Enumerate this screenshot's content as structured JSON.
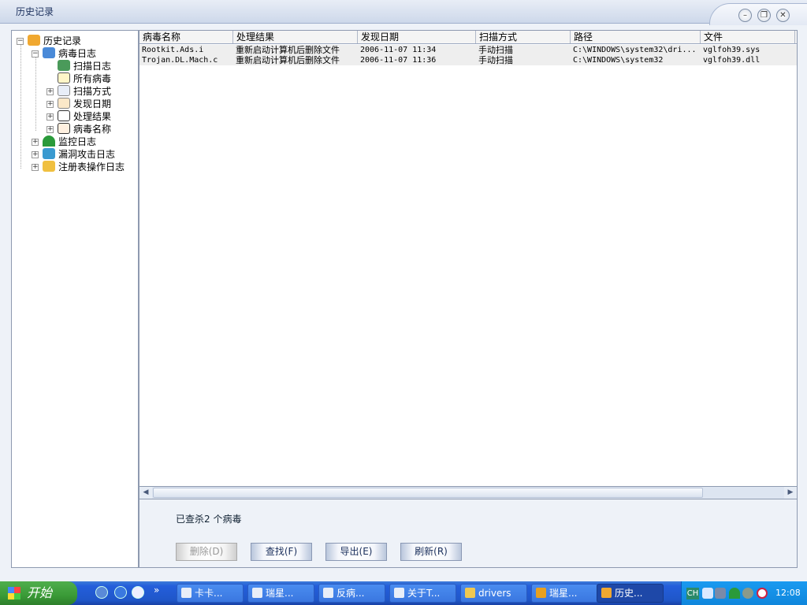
{
  "window": {
    "title": "历史记录",
    "buttons": {
      "minimize": "–",
      "restore": "❐",
      "close": "✕"
    }
  },
  "tree": {
    "root": "历史记录",
    "virus_log": "病毒日志",
    "children": [
      "扫描日志",
      "所有病毒",
      "扫描方式",
      "发现日期",
      "处理结果",
      "病毒名称"
    ],
    "monitor_log": "监控日志",
    "exploit_log": "漏洞攻击日志",
    "registry_log": "注册表操作日志"
  },
  "list": {
    "columns": [
      "病毒名称",
      "处理结果",
      "发现日期",
      "扫描方式",
      "路径",
      "文件"
    ],
    "rows": [
      [
        "Rootkit.Ads.i",
        "重新启动计算机后删除文件",
        "2006-11-07 11:34",
        "手动扫描",
        "C:\\WINDOWS\\system32\\dri...",
        "vglfoh39.sys"
      ],
      [
        "Trojan.DL.Mach.c",
        "重新启动计算机后删除文件",
        "2006-11-07 11:36",
        "手动扫描",
        "C:\\WINDOWS\\system32",
        "vglfoh39.dll"
      ]
    ]
  },
  "status": "已查杀2 个病毒",
  "buttons": {
    "delete": "删除(D)",
    "find": "查找(F)",
    "export": "导出(E)",
    "refresh": "刷新(R)"
  },
  "taskbar": {
    "start": "开始",
    "more": "»",
    "tasks": [
      "卡卡...",
      "瑞星...",
      "反病...",
      "关于T...",
      "drivers",
      "瑞星...",
      "历史..."
    ],
    "lang": "CH",
    "clock": "12:08"
  }
}
